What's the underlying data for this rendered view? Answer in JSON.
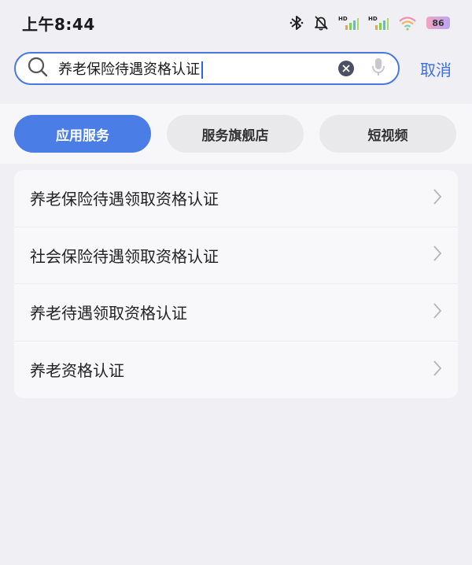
{
  "status_bar": {
    "time": "上午8:44",
    "hd_label_1": "HD",
    "hd_label_2": "HD",
    "battery": "86"
  },
  "search": {
    "query": "养老保险待遇资格认证",
    "cancel_label": "取消"
  },
  "tabs": [
    {
      "label": "应用服务",
      "active": true
    },
    {
      "label": "服务旗舰店",
      "active": false
    },
    {
      "label": "短视频",
      "active": false
    }
  ],
  "results": [
    {
      "label": "养老保险待遇领取资格认证"
    },
    {
      "label": "社会保险待遇领取资格认证"
    },
    {
      "label": "养老待遇领取资格认证"
    },
    {
      "label": "养老资格认证"
    }
  ],
  "colors": {
    "accent": "#4a7ee6",
    "background": "#efeff4"
  }
}
